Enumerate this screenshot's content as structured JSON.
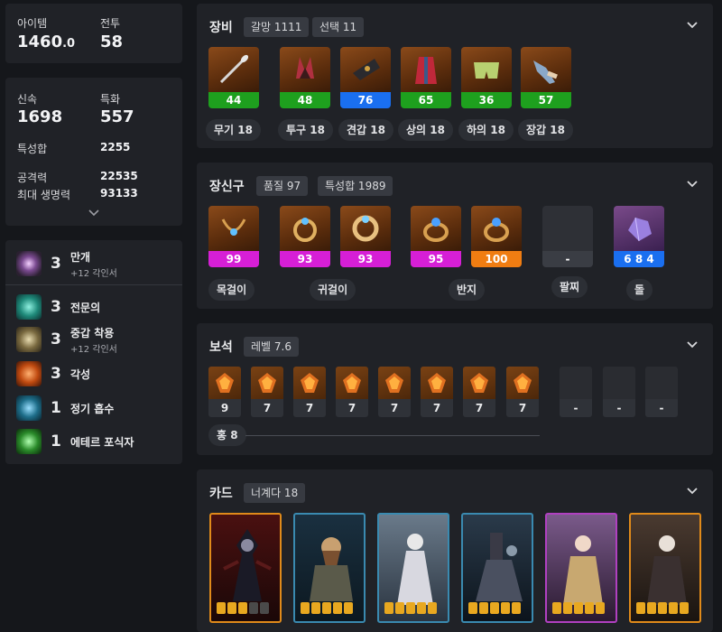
{
  "summary": {
    "item_level_label": "아이템",
    "item_level_main": "1460",
    "item_level_decimal": ".0",
    "battle_level_label": "전투",
    "battle_level": "58"
  },
  "stats": {
    "swift_label": "신속",
    "swift": "1698",
    "crit_label": "특화",
    "crit": "557",
    "total_label": "특성합",
    "total": "2255",
    "attack_label": "공격력",
    "attack": "22535",
    "hp_label": "최대 생명력",
    "hp": "93133"
  },
  "engravings": [
    {
      "level": "3",
      "name": "만개",
      "sub": "+12 각인서",
      "icon": "burst-icon"
    },
    {
      "level": "3",
      "name": "전문의",
      "sub": "",
      "icon": "doctor-icon"
    },
    {
      "level": "3",
      "name": "중갑 착용",
      "sub": "+12 각인서",
      "icon": "armor-icon"
    },
    {
      "level": "3",
      "name": "각성",
      "sub": "",
      "icon": "awaken-icon"
    },
    {
      "level": "1",
      "name": "정기 흡수",
      "sub": "",
      "icon": "absorb-icon"
    },
    {
      "level": "1",
      "name": "에테르 포식자",
      "sub": "",
      "icon": "ether-icon"
    }
  ],
  "equipment": {
    "title": "장비",
    "tag1": "갈망 1111",
    "tag2": "선택 11",
    "items": [
      {
        "quality": "44",
        "label": "무기 18",
        "color": "#1ea01e"
      },
      {
        "quality": "48",
        "label": "투구 18",
        "color": "#1ea01e"
      },
      {
        "quality": "76",
        "label": "견갑 18",
        "color": "#1a6ff0"
      },
      {
        "quality": "65",
        "label": "상의 18",
        "color": "#1ea01e"
      },
      {
        "quality": "36",
        "label": "하의 18",
        "color": "#1ea01e"
      },
      {
        "quality": "57",
        "label": "장갑 18",
        "color": "#1ea01e"
      }
    ]
  },
  "accessories": {
    "title": "장신구",
    "tag1": "품질 97",
    "tag2": "특성합 1989",
    "items": [
      {
        "quality": "99",
        "color": "#d61fd6"
      },
      {
        "quality": "93",
        "color": "#d61fd6"
      },
      {
        "quality": "93",
        "color": "#d61fd6"
      },
      {
        "quality": "95",
        "color": "#d61fd6"
      },
      {
        "quality": "100",
        "color": "#f07d12"
      },
      {
        "quality": "-",
        "color": "#3a3d44"
      },
      {
        "quality": "6 8 4",
        "color": "#1a6ff0"
      }
    ],
    "labels": {
      "necklace": "목걸이",
      "earring": "귀걸이",
      "ring": "반지",
      "bracelet": "팔찌",
      "stone": "돌"
    }
  },
  "gems": {
    "title": "보석",
    "tag1": "레벨 7.6",
    "levels": [
      "9",
      "7",
      "7",
      "7",
      "7",
      "7",
      "7",
      "7",
      "-",
      "-",
      "-"
    ],
    "summary": "홍 8"
  },
  "cards": {
    "title": "카드",
    "tag1": "너계다 18"
  }
}
